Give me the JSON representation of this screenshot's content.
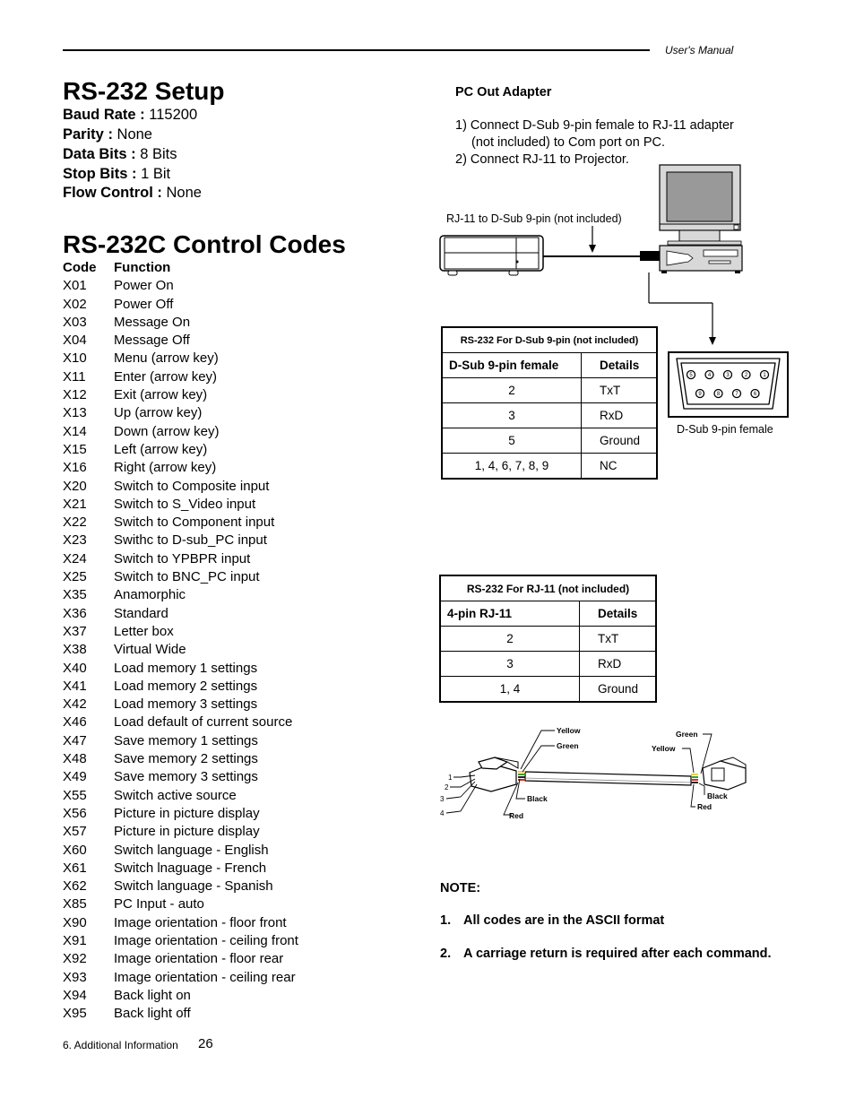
{
  "header": {
    "manual_title": "User's Manual"
  },
  "setup": {
    "title": "RS-232 Setup",
    "params": [
      {
        "label": "Baud Rate :",
        "value": "115200"
      },
      {
        "label": "Parity :",
        "value": "None"
      },
      {
        "label": "Data Bits :",
        "value": "8 Bits"
      },
      {
        "label": "Stop Bits :",
        "value": "1 Bit"
      },
      {
        "label": "Flow Control :",
        "value": "None"
      }
    ]
  },
  "codes": {
    "title": "RS-232C Control Codes",
    "header": {
      "code": "Code",
      "function": "Function"
    },
    "rows": [
      {
        "code": "X01",
        "function": "Power On"
      },
      {
        "code": "X02",
        "function": "Power Off"
      },
      {
        "code": "X03",
        "function": "Message On"
      },
      {
        "code": "X04",
        "function": "Message Off"
      },
      {
        "code": "X10",
        "function": "Menu (arrow key)"
      },
      {
        "code": "X11",
        "function": "Enter (arrow key)"
      },
      {
        "code": "X12",
        "function": "Exit (arrow key)"
      },
      {
        "code": "X13",
        "function": "Up (arrow key)"
      },
      {
        "code": "X14",
        "function": "Down (arrow key)"
      },
      {
        "code": "X15",
        "function": "Left (arrow key)"
      },
      {
        "code": "X16",
        "function": "Right (arrow key)"
      },
      {
        "code": "X20",
        "function": "Switch to Composite input"
      },
      {
        "code": "X21",
        "function": "Switch to S_Video input"
      },
      {
        "code": "X22",
        "function": "Switch to Component input"
      },
      {
        "code": "X23",
        "function": "Swithc to D-sub_PC input"
      },
      {
        "code": "X24",
        "function": "Switch to YPBPR input"
      },
      {
        "code": "X25",
        "function": "Switch to BNC_PC input"
      },
      {
        "code": "X35",
        "function": "Anamorphic"
      },
      {
        "code": "X36",
        "function": "Standard"
      },
      {
        "code": "X37",
        "function": "Letter box"
      },
      {
        "code": "X38",
        "function": "Virtual Wide"
      },
      {
        "code": "X40",
        "function": "Load memory 1 settings"
      },
      {
        "code": "X41",
        "function": "Load memory 2 settings"
      },
      {
        "code": "X42",
        "function": "Load memory 3 settings"
      },
      {
        "code": "X46",
        "function": "Load default of current source"
      },
      {
        "code": "X47",
        "function": "Save memory 1 settings"
      },
      {
        "code": "X48",
        "function": "Save memory 2 settings"
      },
      {
        "code": "X49",
        "function": "Save memory 3 settings"
      },
      {
        "code": "X55",
        "function": "Switch active source"
      },
      {
        "code": "X56",
        "function": "Picture in picture display"
      },
      {
        "code": "X57",
        "function": "Picture in picture display"
      },
      {
        "code": "X60",
        "function": "Switch language - English"
      },
      {
        "code": "X61",
        "function": "Switch lnaguage - French"
      },
      {
        "code": "X62",
        "function": "Switch language - Spanish"
      },
      {
        "code": "X85",
        "function": "PC Input - auto"
      },
      {
        "code": "X90",
        "function": "Image orientation - floor front"
      },
      {
        "code": "X91",
        "function": "Image orientation - ceiling front"
      },
      {
        "code": "X92",
        "function": "Image orientation - floor rear"
      },
      {
        "code": "X93",
        "function": "Image orientation - ceiling rear"
      },
      {
        "code": "X94",
        "function": "Back light on"
      },
      {
        "code": "X95",
        "function": "Back light off"
      }
    ]
  },
  "adapter": {
    "title": "PC Out Adapter",
    "steps": [
      "1) Connect D-Sub 9-pin female to RJ-11 adapter",
      "(not included) to Com port on PC.",
      "2) Connect RJ-11 to Projector."
    ],
    "cable_label": "RJ-11 to D-Sub 9-pin (not included)",
    "dsub_label": "D-Sub 9-pin female",
    "dsub_pins_top": [
      "5",
      "4",
      "3",
      "2",
      "1"
    ],
    "dsub_pins_bottom": [
      "9",
      "8",
      "7",
      "6"
    ]
  },
  "table_dsub": {
    "caption": "RS-232 For D-Sub 9-pin (not included)",
    "headers": [
      "D-Sub 9-pin female",
      "Details"
    ],
    "rows": [
      [
        "2",
        "TxT"
      ],
      [
        "3",
        "RxD"
      ],
      [
        "5",
        "Ground"
      ],
      [
        "1, 4, 6, 7, 8, 9",
        "NC"
      ]
    ]
  },
  "table_rj11": {
    "caption": "RS-232 For RJ-11 (not included)",
    "headers": [
      "4-pin RJ-11",
      "Details"
    ],
    "rows": [
      [
        "2",
        "TxT"
      ],
      [
        "3",
        "RxD"
      ],
      [
        "1, 4",
        "Ground"
      ]
    ]
  },
  "cable_diagram": {
    "pin_numbers": [
      "1",
      "2",
      "3",
      "4"
    ],
    "left_wires": {
      "yellow": "Yellow",
      "green": "Green",
      "black": "Black",
      "red": "Red"
    },
    "right_wires": {
      "green": "Green",
      "yellow": "Yellow",
      "black": "Black",
      "red": "Red"
    },
    "wire_colors": {
      "yellow": "#e8d23a",
      "green": "#3a9a3a",
      "red": "#c8302a",
      "black": "#222222"
    }
  },
  "note": {
    "title": "NOTE:",
    "items": [
      {
        "num": "1.",
        "text": "All codes are in the ASCII format"
      },
      {
        "num": "2.",
        "text": "A carriage return is required after each command."
      }
    ]
  },
  "footer": {
    "section": "6. Additional Information",
    "page": "26"
  }
}
